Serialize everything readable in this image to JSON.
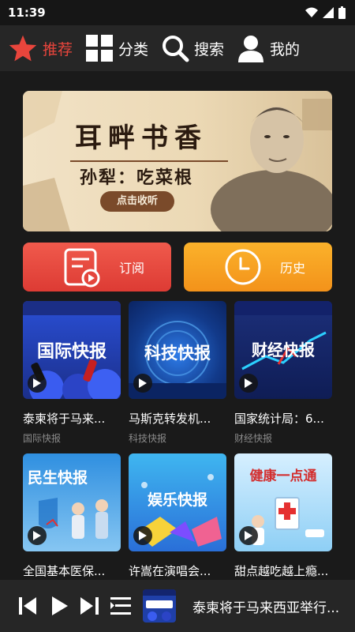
{
  "status": {
    "time": "11:39"
  },
  "nav": {
    "recommend": "推荐",
    "category": "分类",
    "search": "搜索",
    "mine": "我的"
  },
  "banner": {
    "title": "耳畔书香",
    "subtitle": "孙犁：吃菜根",
    "cta": "点击收听"
  },
  "quick": {
    "subscribe": "订阅",
    "history": "历史"
  },
  "cards": [
    {
      "title": "泰柬将于马来...",
      "subtitle": "国际快报",
      "cover_text": "国际快报"
    },
    {
      "title": "马斯克转发机...",
      "subtitle": "科技快报",
      "cover_text": "科技快报"
    },
    {
      "title": "国家统计局：6...",
      "subtitle": "财经快报",
      "cover_text": "财经快报"
    },
    {
      "title": "全国基本医保...",
      "subtitle": "",
      "cover_text": "民生快报"
    },
    {
      "title": "许嵩在演唱会...",
      "subtitle": "",
      "cover_text": "娱乐快报"
    },
    {
      "title": "甜点越吃越上瘾...",
      "subtitle": "",
      "cover_text": "健康一点通"
    }
  ],
  "player": {
    "now_playing": "泰柬将于马来西亚举行..."
  },
  "colors": {
    "accent": "#e8453c",
    "subscribe_btn": "#e8453c",
    "history_btn": "#f5a01f"
  }
}
